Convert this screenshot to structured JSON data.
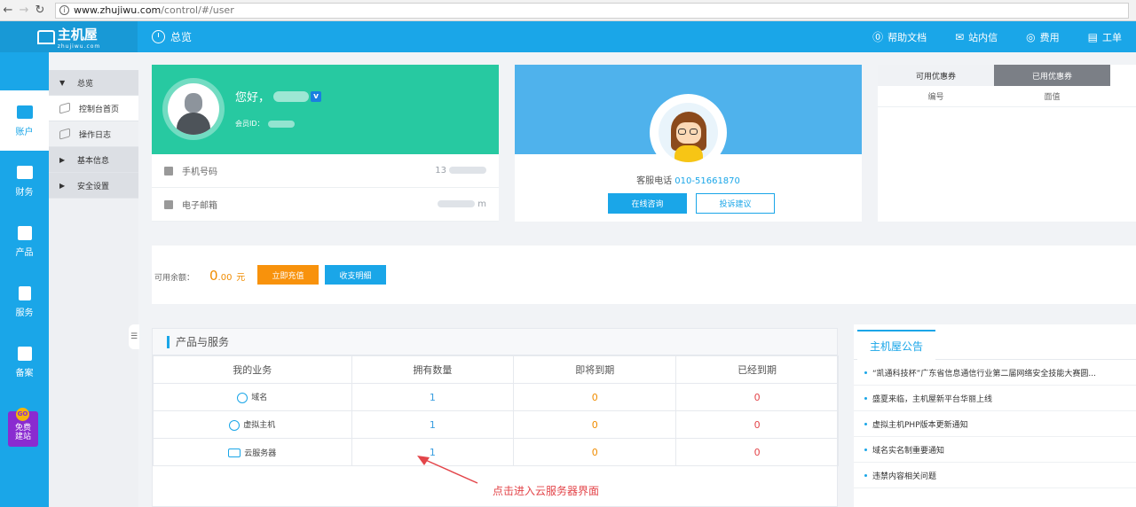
{
  "browser": {
    "url_host": "www.zhujiwu.com",
    "url_path": "/control/#/user"
  },
  "header": {
    "logo_text": "主机屋",
    "logo_sub": "zhujiwu.com",
    "title": "总览",
    "links": [
      {
        "icon": "help-icon",
        "label": "帮助文档"
      },
      {
        "icon": "mail-icon",
        "label": "站内信"
      },
      {
        "icon": "fee-icon",
        "label": "费用"
      },
      {
        "icon": "ticket-icon",
        "label": "工单"
      }
    ]
  },
  "leftnav": {
    "items": [
      {
        "label": "账户",
        "active": true
      },
      {
        "label": "财务"
      },
      {
        "label": "产品"
      },
      {
        "label": "服务"
      },
      {
        "label": "备案"
      }
    ],
    "promo": {
      "badge": "GO",
      "text1": "免费",
      "text2": "建站"
    }
  },
  "subnav": {
    "overview": "总览",
    "dashboard": "控制台首页",
    "oplog": "操作日志",
    "basic_info": "基本信息",
    "security": "安全设置"
  },
  "profile": {
    "greeting": "您好，",
    "member_id_label": "会员ID：",
    "phone_label": "手机号码",
    "phone_value": "13",
    "email_label": "电子邮箱",
    "email_value": "m"
  },
  "service": {
    "phone_label": "客服电话",
    "phone_number": "010-51661870",
    "consult_btn": "在线咨询",
    "complaint_btn": "投诉建议"
  },
  "coupon": {
    "tab_available": "可用优惠券",
    "tab_used": "已用优惠券",
    "col_no": "编号",
    "col_value": "面值"
  },
  "balance": {
    "label": "可用余额：",
    "amount_int": "0",
    "amount_dec": ".00",
    "unit": "元",
    "recharge_btn": "立即充值",
    "detail_btn": "收支明细"
  },
  "products": {
    "title": "产品与服务",
    "headers": [
      "我的业务",
      "拥有数量",
      "即将到期",
      "已经到期"
    ],
    "rows": [
      {
        "name": "域名",
        "owned": "1",
        "expiring": "0",
        "expired": "0"
      },
      {
        "name": "虚拟主机",
        "owned": "1",
        "expiring": "0",
        "expired": "0"
      },
      {
        "name": "云服务器",
        "owned": "1",
        "expiring": "0",
        "expired": "0"
      }
    ]
  },
  "annotation": "点击进入云服务器界面",
  "notice": {
    "title": "主机屋公告",
    "items": [
      "“凯通科技杯”广东省信息通信行业第二届网络安全技能大赛圆...",
      "盛夏来临，主机屋新平台华丽上线",
      "虚拟主机PHP版本更新通知",
      "域名实名制重要通知",
      "违禁内容相关问题"
    ]
  },
  "colors": {
    "brand": "#1aa6e8",
    "profile": "#27c9a1",
    "service": "#4fb2ec",
    "warn": "#f8920c",
    "danger": "#e3454a"
  }
}
